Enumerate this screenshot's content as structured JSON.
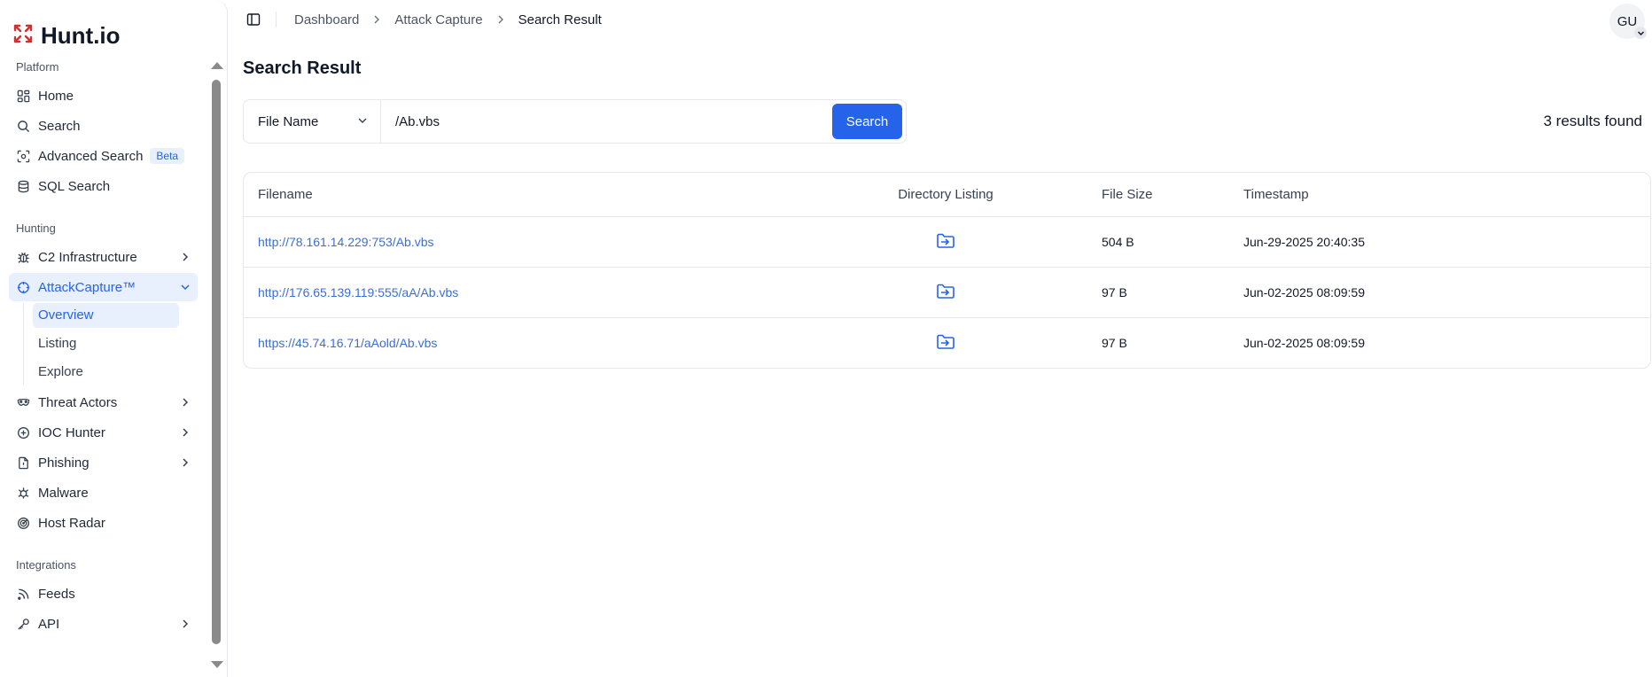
{
  "brand": {
    "name": "Hunt.io"
  },
  "sidebar": {
    "sections": {
      "platform": "Platform",
      "hunting": "Hunting",
      "integrations": "Integrations"
    },
    "platform_items": [
      {
        "label": "Home",
        "icon": "home-grid-icon"
      },
      {
        "label": "Search",
        "icon": "search-icon"
      },
      {
        "label": "Advanced Search",
        "icon": "scan-icon",
        "badge": "Beta"
      },
      {
        "label": "SQL Search",
        "icon": "database-icon"
      }
    ],
    "hunting_items": [
      {
        "label": "C2 Infrastructure",
        "icon": "bug-icon"
      },
      {
        "label": "AttackCapture™",
        "icon": "crosshair-icon",
        "expanded": true,
        "children": [
          "Overview",
          "Listing",
          "Explore"
        ],
        "active_child": "Overview"
      },
      {
        "label": "Threat Actors",
        "icon": "mask-icon"
      },
      {
        "label": "IOC Hunter",
        "icon": "plus-circle-icon"
      },
      {
        "label": "Phishing",
        "icon": "file-warning-icon"
      },
      {
        "label": "Malware",
        "icon": "virus-icon"
      },
      {
        "label": "Host Radar",
        "icon": "radar-icon"
      }
    ],
    "integration_items": [
      {
        "label": "Feeds",
        "icon": "rss-icon"
      },
      {
        "label": "API",
        "icon": "key-icon"
      }
    ]
  },
  "breadcrumb": [
    "Dashboard",
    "Attack Capture",
    "Search Result"
  ],
  "user": {
    "initials": "GU"
  },
  "page": {
    "title": "Search Result"
  },
  "search": {
    "field": "File Name",
    "query": "/Ab.vbs",
    "button": "Search",
    "results_count": "3 results found"
  },
  "table": {
    "columns": [
      "Filename",
      "Directory Listing",
      "File Size",
      "Timestamp"
    ],
    "rows": [
      {
        "filename": "http://78.161.14.229:753/Ab.vbs",
        "size": "504 B",
        "timestamp": "Jun-29-2025 20:40:35"
      },
      {
        "filename": "http://176.65.139.119:555/aA/Ab.vbs",
        "size": "97 B",
        "timestamp": "Jun-02-2025 08:09:59"
      },
      {
        "filename": "https://45.74.16.71/aAold/Ab.vbs",
        "size": "97 B",
        "timestamp": "Jun-02-2025 08:09:59"
      }
    ]
  },
  "colors": {
    "accent": "#2563eb",
    "logo": "#d32f2f",
    "link": "#3b6fd6"
  }
}
